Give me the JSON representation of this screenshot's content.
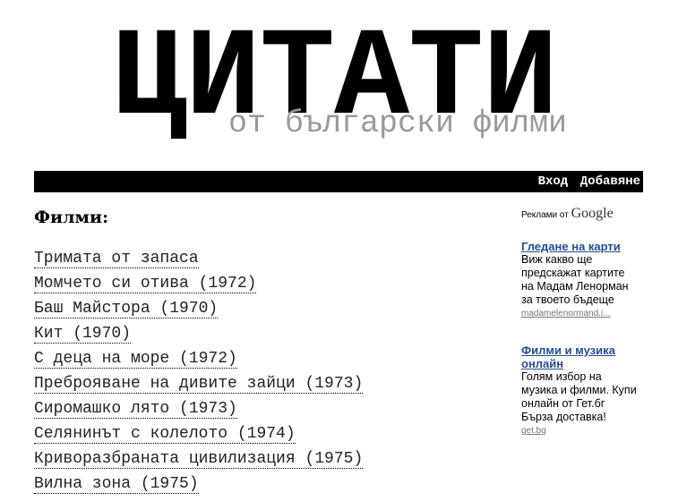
{
  "header": {
    "title": "ЦИТАТИ",
    "subtitle": "от български филми"
  },
  "nav": {
    "login": "Вход",
    "add": "Добавяне"
  },
  "main": {
    "heading": "Филми:",
    "films": [
      "Тримата от запаса",
      "Момчето си отива (1972)",
      "Баш Майстора (1970)",
      "Кит (1970)",
      "С деца на море (1972)",
      "Преброяване на дивите зайци (1973)",
      "Сиромашко лято (1973)",
      "Селянинът с колелото (1974)",
      "Криворазбраната цивилизация (1975)",
      "Вилна зона (1975)"
    ]
  },
  "ads": {
    "label": "Реклами от",
    "brand": "Google",
    "items": [
      {
        "title": "Гледане на карти",
        "text": "Виж какво ще предскажат картите на Мадам Ленорман за твоето бъдеще",
        "url": "madamelenormand.i..."
      },
      {
        "title": "Филми и музика онлайн",
        "text": "Голям избор на музика и филми. Купи онлайн от Гет.бг Бърза доставка!",
        "url": "get.bg"
      }
    ]
  }
}
